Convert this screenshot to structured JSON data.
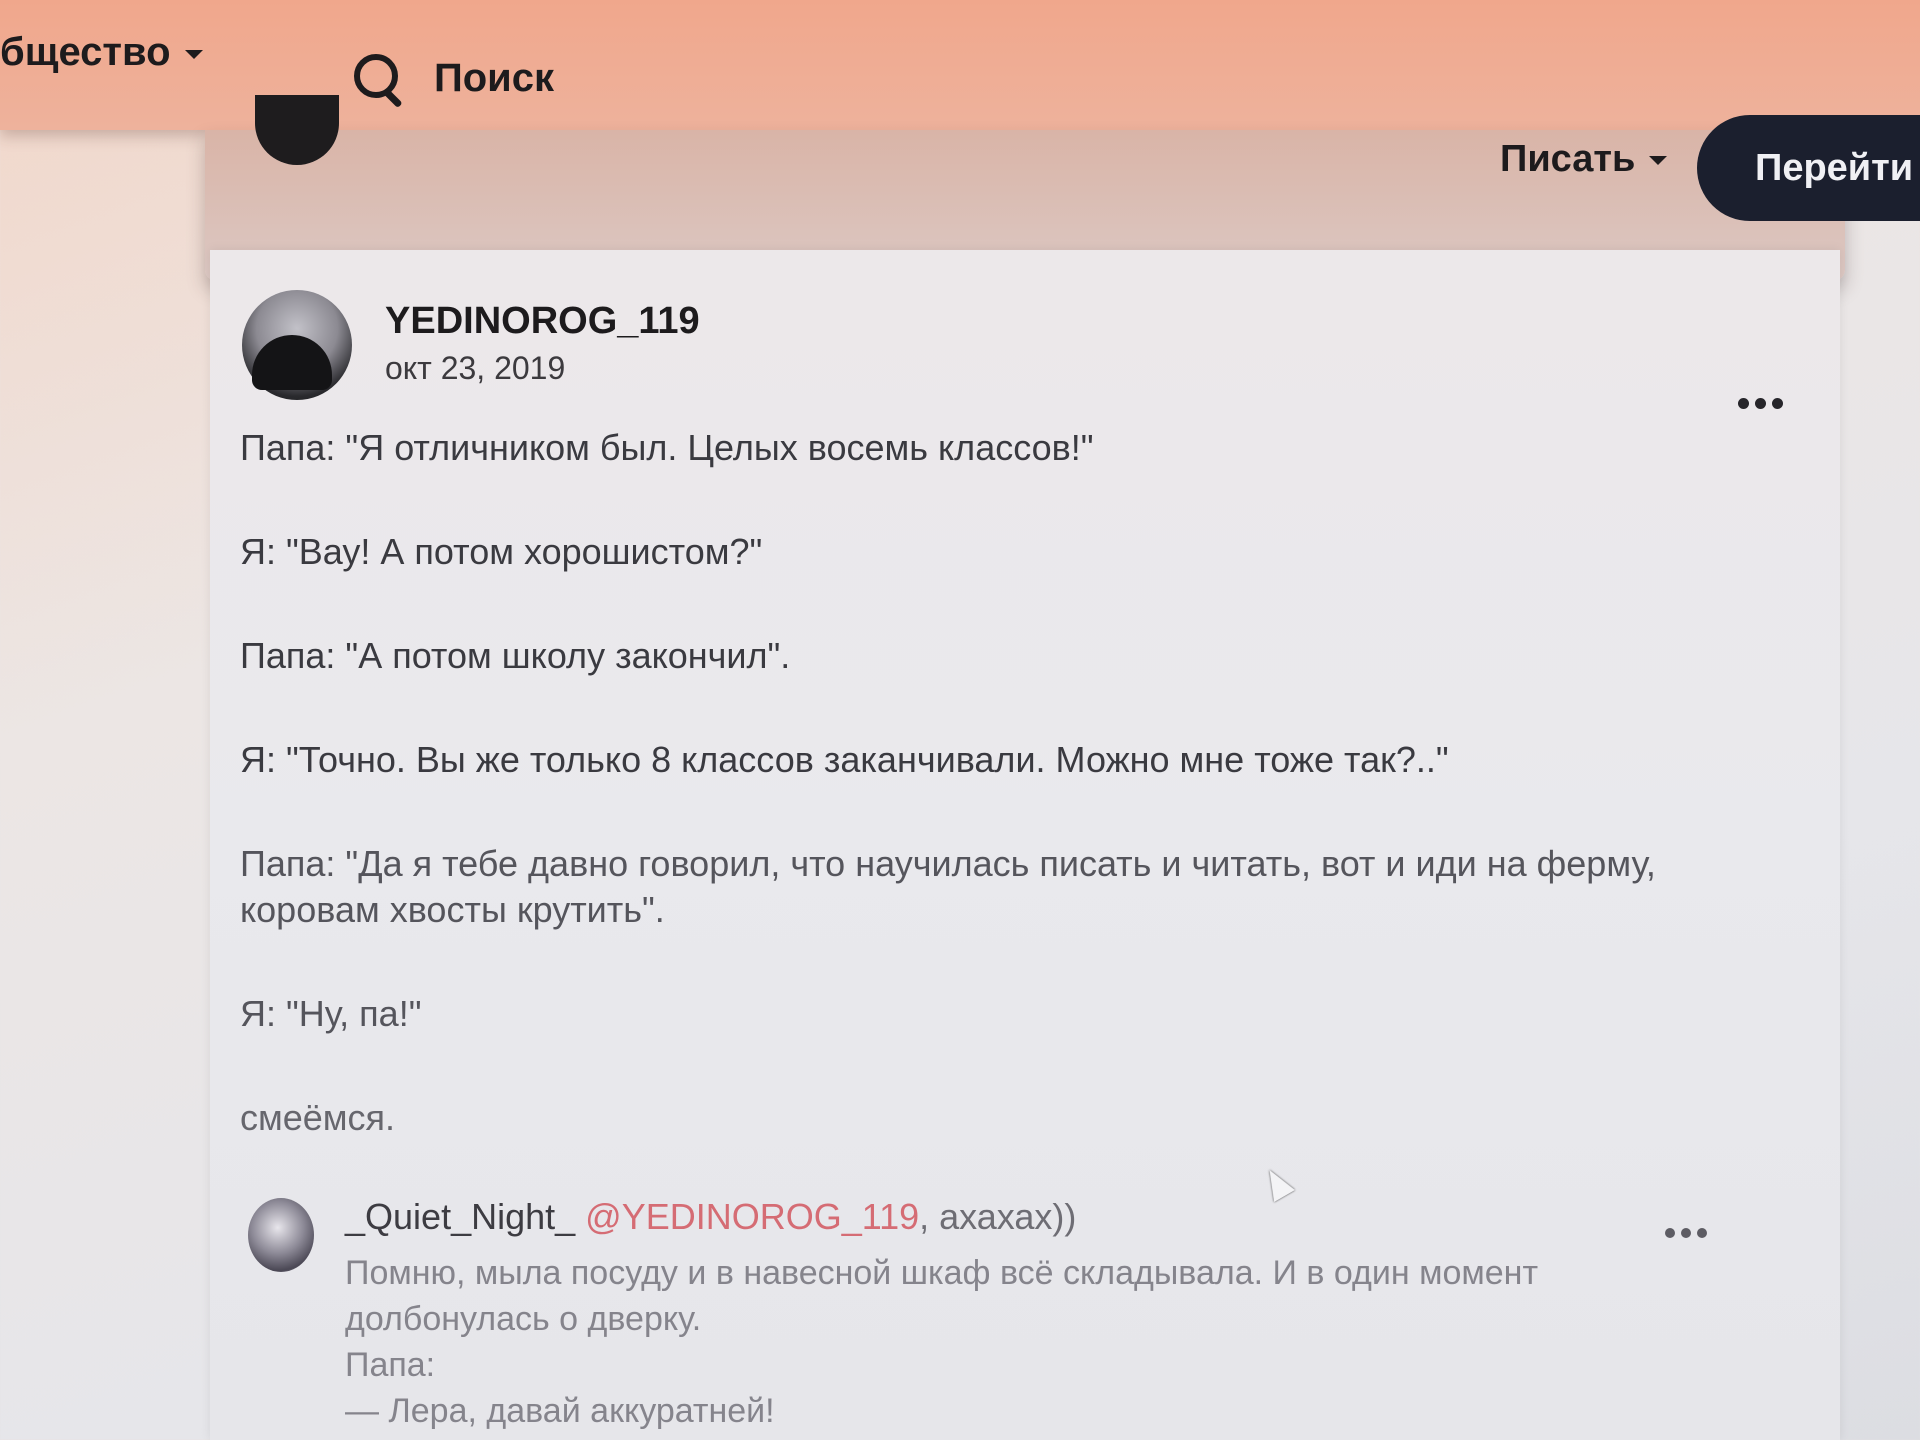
{
  "nav": {
    "community_label": "бщество",
    "search_label": "Поиск"
  },
  "subbar": {
    "write_label": "Писать",
    "go_label": "Перейти к"
  },
  "post": {
    "author": "YEDINOROG_119",
    "date": "окт 23, 2019",
    "paragraphs": [
      "Папа: \"Я отличником был. Целых восемь классов!\"",
      "Я: \"Вау! А потом хорошистом?\"",
      "Папа: \"А потом школу закончил\".",
      "Я: \"Точно. Вы же только 8 классов заканчивали. Можно мне тоже так?..\"",
      "Папа: \"Да я тебе давно говорил, что научилась писать и читать, вот и иди на ферму, коровам хвосты крутить\".",
      "Я: \"Ну, па!\"",
      "смеёмся."
    ]
  },
  "comment": {
    "author": "_Quiet_Night_",
    "mention": "@YEDINOROG_119",
    "after_mention": ", ахахах))",
    "lines": [
      "Помню, мыла посуду и в навесной шкаф всё складывала. И в один момент долбонулась о дверку.",
      "Папа:",
      "— Лера, давай аккуратней!"
    ]
  },
  "colors": {
    "topbar": "#f0a78c",
    "button_dark": "#1b1f2e",
    "mention": "#d56c74"
  }
}
